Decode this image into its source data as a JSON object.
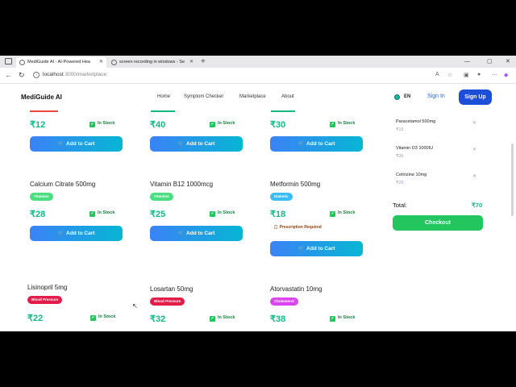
{
  "browser": {
    "tabs": [
      {
        "title": "MediGuide AI - AI-Powered Hea"
      },
      {
        "title": "screen recording in windows - Se"
      }
    ],
    "url_host": "localhost",
    "url_path": ":3000/marketplace"
  },
  "header": {
    "logo": "MediGuide AI",
    "nav": [
      "Home",
      "Symptom Checker",
      "Marketplace",
      "About"
    ],
    "lang": "EN",
    "signin": "Sign In",
    "signup": "Sign Up"
  },
  "common": {
    "in_stock": "In Stock",
    "add_to_cart": "Add to Cart",
    "prescription": "Prescription Required"
  },
  "products": [
    {
      "price": "₹12"
    },
    {
      "price": "₹40"
    },
    {
      "price": "₹30"
    },
    {
      "name": "Calcium Citrate 500mg",
      "tag": "Vitamins",
      "tag_color": "#4ade80",
      "price": "₹28"
    },
    {
      "name": "Vitamin B12 1000mcg",
      "tag": "Vitamins",
      "tag_color": "#4ade80",
      "price": "₹25"
    },
    {
      "name": "Metformin 500mg",
      "tag": "Diabetic",
      "tag_color": "#38bdf8",
      "price": "₹18"
    },
    {
      "name": "Lisinopril 5mg",
      "tag": "Blood Pressure",
      "tag_color": "#e11d48",
      "price": "₹22"
    },
    {
      "name": "Losartan 50mg",
      "tag": "Blood Pressure",
      "tag_color": "#e11d48",
      "price": "₹32"
    },
    {
      "name": "Atorvastatin 10mg",
      "tag": "Cholesterol",
      "tag_color": "#d946ef",
      "price": "₹38"
    }
  ],
  "cart": {
    "items": [
      {
        "name": "Paracetamol 500mg",
        "price": "₹15"
      },
      {
        "name": "Vitamin D3 1000IU",
        "price": "₹35"
      },
      {
        "name": "Cetirizine 10mg",
        "price": "₹20"
      }
    ],
    "total_label": "Total:",
    "total_value": "₹70",
    "checkout": "Checkout"
  }
}
